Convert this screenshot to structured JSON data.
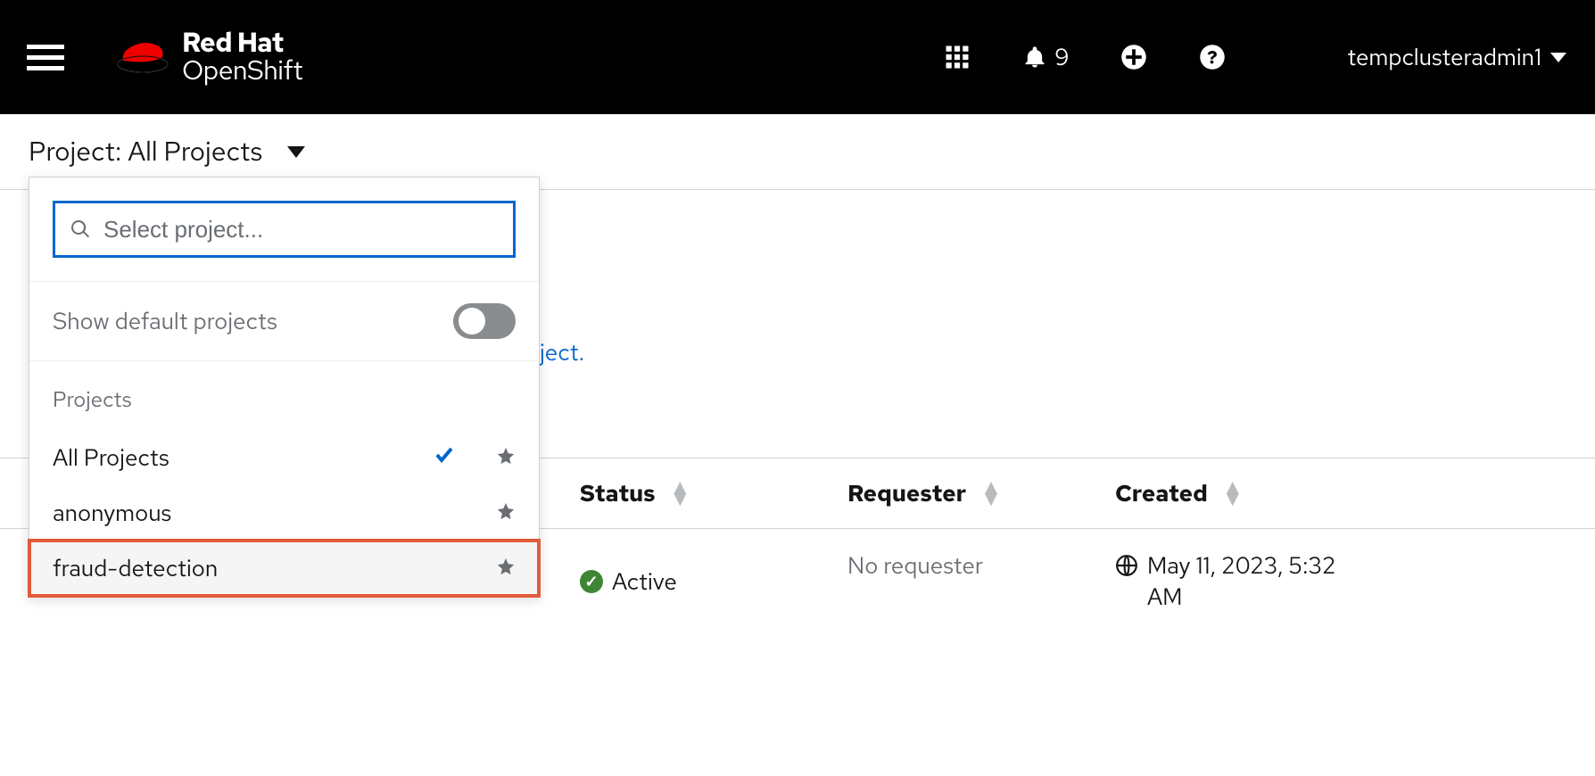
{
  "header": {
    "brand_top": "Red Hat",
    "brand_bot": "OpenShift",
    "notification_count": "9",
    "username": "tempclusteradmin1"
  },
  "project_bar": {
    "label_prefix": "Project:",
    "current": "All Projects"
  },
  "dropdown": {
    "search_placeholder": "Select project...",
    "toggle_label": "Show default projects",
    "section_label": "Projects",
    "items": [
      {
        "label": "All Projects",
        "checked": true,
        "highlighted": false
      },
      {
        "label": "anonymous",
        "checked": false,
        "highlighted": false
      },
      {
        "label": "fraud-detection",
        "checked": false,
        "highlighted": true
      }
    ]
  },
  "peek_link_fragment": "ject.",
  "table": {
    "columns": {
      "status": "Status",
      "requester": "Requester",
      "created": "Created"
    },
    "row": {
      "status": "Active",
      "requester": "No requester",
      "created": "May 11, 2023, 5:32 AM"
    }
  }
}
